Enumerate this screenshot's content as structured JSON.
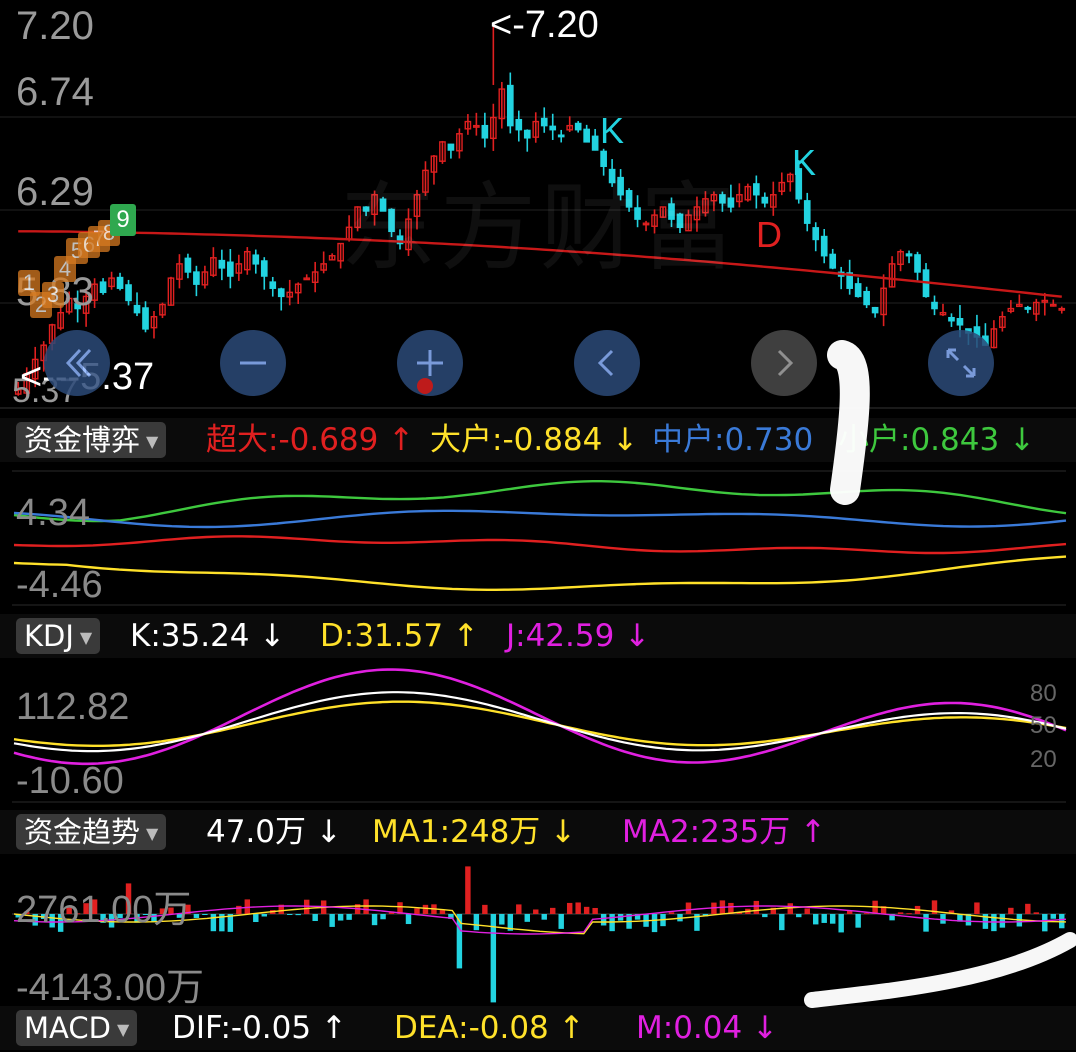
{
  "colors": {
    "up": "#e02020",
    "down": "#22d3e0",
    "ma": "#c81818",
    "white": "#ffffff",
    "yellow": "#ffe12a",
    "magenta": "#e020e0",
    "blue": "#3a7ad8",
    "green": "#3ec83e",
    "red": "#e02020"
  },
  "main": {
    "price_labels": [
      "7.20",
      "6.74",
      "6.29",
      "5.83",
      "5.37"
    ],
    "high_marker": "<-7.20",
    "low_marker": "<---5.37",
    "k_marks": [
      "K",
      "K"
    ],
    "d_mark": "D",
    "watermark": "东方财富",
    "badges": [
      "1",
      "2",
      "3",
      "4",
      "5",
      "6",
      "7",
      "8",
      "9"
    ],
    "nav_icons": [
      "double-left-icon",
      "zoom-out-icon",
      "zoom-in-icon",
      "prev-icon",
      "next-icon",
      "expand-icon"
    ]
  },
  "funds_game": {
    "selector": "资金博弈",
    "items": [
      {
        "label": "超大:-0.689",
        "arrow": "↑",
        "color": "#e02020"
      },
      {
        "label": "大户:-0.884",
        "arrow": "↓",
        "color": "#ffe12a"
      },
      {
        "label": "中户:0.730",
        "arrow": "",
        "color": "#3a7ad8"
      },
      {
        "label": "小户:0.843",
        "arrow": "↓",
        "color": "#3ec83e"
      }
    ],
    "ymax": "4.34",
    "ymin": "-4.46"
  },
  "kdj": {
    "selector": "KDJ",
    "items": [
      {
        "label": "K:35.24",
        "arrow": "↓",
        "color": "#ffffff"
      },
      {
        "label": "D:31.57",
        "arrow": "↑",
        "color": "#ffe12a"
      },
      {
        "label": "J:42.59",
        "arrow": "↓",
        "color": "#e020e0"
      }
    ],
    "ymax": "112.82",
    "ymin": "-10.60",
    "levels": [
      "80",
      "50",
      "20"
    ]
  },
  "trend": {
    "selector": "资金趋势",
    "items": [
      {
        "label": "47.0万",
        "arrow": "↓",
        "color": "#ffffff"
      },
      {
        "label": "MA1:248万",
        "arrow": "↓",
        "color": "#ffe12a"
      },
      {
        "label": "MA2:235万",
        "arrow": "↑",
        "color": "#e020e0"
      }
    ],
    "ymax": "2761.00万",
    "ymin": "-4143.00万"
  },
  "macd": {
    "selector": "MACD",
    "items": [
      {
        "label": "DIF:-0.05",
        "arrow": "↑",
        "color": "#ffffff"
      },
      {
        "label": "DEA:-0.08",
        "arrow": "↑",
        "color": "#ffe12a"
      },
      {
        "label": "M:0.04",
        "arrow": "↓",
        "color": "#e020e0"
      }
    ]
  },
  "chart_data": {
    "type": "candlestick",
    "ylim": [
      5.37,
      7.2
    ],
    "closes": [
      5.4,
      5.48,
      5.55,
      5.62,
      5.72,
      5.78,
      5.85,
      5.8,
      5.86,
      5.92,
      5.88,
      5.95,
      5.9,
      5.84,
      5.78,
      5.7,
      5.76,
      5.82,
      5.95,
      6.02,
      5.98,
      5.92,
      5.98,
      6.05,
      6.0,
      5.96,
      6.02,
      6.08,
      6.02,
      5.96,
      5.9,
      5.86,
      5.88,
      5.92,
      5.95,
      5.98,
      6.02,
      6.06,
      6.12,
      6.2,
      6.3,
      6.28,
      6.36,
      6.28,
      6.18,
      6.12,
      6.24,
      6.36,
      6.48,
      6.55,
      6.62,
      6.58,
      6.66,
      6.72,
      6.7,
      6.64,
      6.74,
      6.88,
      6.7,
      6.68,
      6.64,
      6.72,
      6.7,
      6.68,
      6.65,
      6.7,
      6.68,
      6.62,
      6.58,
      6.5,
      6.42,
      6.36,
      6.3,
      6.24,
      6.22,
      6.26,
      6.3,
      6.24,
      6.2,
      6.26,
      6.3,
      6.34,
      6.36,
      6.32,
      6.3,
      6.36,
      6.4,
      6.36,
      6.32,
      6.36,
      6.42,
      6.46,
      6.34,
      6.22,
      6.14,
      6.06,
      6.0,
      5.96,
      5.9,
      5.86,
      5.82,
      5.78,
      5.9,
      6.02,
      6.08,
      6.06,
      5.98,
      5.86,
      5.8,
      5.78,
      5.74,
      5.72,
      5.68,
      5.66,
      5.62,
      5.7,
      5.76,
      5.8,
      5.82,
      5.8,
      5.83,
      5.84,
      5.82,
      5.8
    ]
  }
}
